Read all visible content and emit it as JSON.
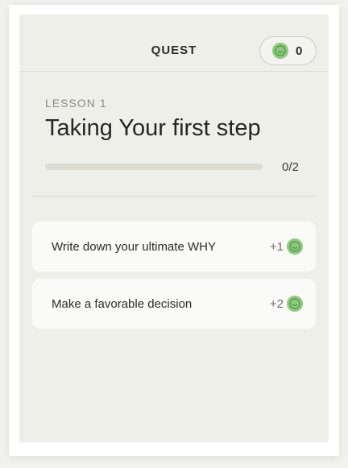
{
  "header": {
    "title": "QUEST",
    "coins": "0"
  },
  "lesson": {
    "label": "LESSON 1",
    "title": "Taking Your first step",
    "progress": {
      "done": 0,
      "total": 2,
      "text": "0/2"
    }
  },
  "tasks": [
    {
      "label": "Write down your ultimate WHY",
      "reward": "+1"
    },
    {
      "label": "Make a favorable decision",
      "reward": "+2"
    }
  ],
  "colors": {
    "accent": "#8dc97f",
    "panel": "#efefea",
    "card": "#fafaf8"
  },
  "icons": {
    "coin": "smiley-coin-icon"
  }
}
